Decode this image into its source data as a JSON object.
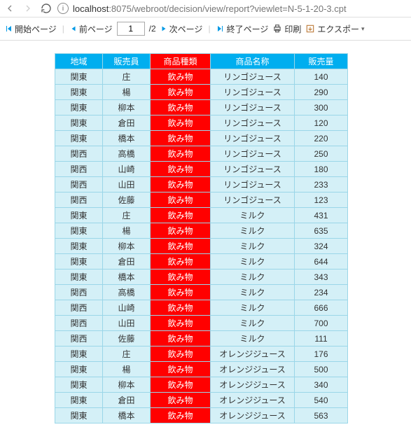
{
  "browser": {
    "url_host": "localhost",
    "url_port": ":8075",
    "url_path": "/webroot/decision/view/report?viewlet=N-5-1-20-3.cpt"
  },
  "toolbar": {
    "first_page": "開始ページ",
    "prev_page": "前ページ",
    "page_current": "1",
    "page_total": "/2",
    "next_page": "次ページ",
    "last_page": "終了ページ",
    "print": "印刷",
    "export": "エクスポー"
  },
  "table": {
    "headers": {
      "region": "地域",
      "seller": "販売員",
      "type": "商品種類",
      "name": "商品名称",
      "qty": "販売量"
    },
    "rows": [
      {
        "region": "関東",
        "seller": "庄",
        "type": "飲み物",
        "name": "リンゴジュース",
        "qty": 140
      },
      {
        "region": "関東",
        "seller": "楊",
        "type": "飲み物",
        "name": "リンゴジュース",
        "qty": 290
      },
      {
        "region": "関東",
        "seller": "柳本",
        "type": "飲み物",
        "name": "リンゴジュース",
        "qty": 300
      },
      {
        "region": "関東",
        "seller": "倉田",
        "type": "飲み物",
        "name": "リンゴジュース",
        "qty": 120
      },
      {
        "region": "関東",
        "seller": "橋本",
        "type": "飲み物",
        "name": "リンゴジュース",
        "qty": 220
      },
      {
        "region": "関西",
        "seller": "高橋",
        "type": "飲み物",
        "name": "リンゴジュース",
        "qty": 250
      },
      {
        "region": "関西",
        "seller": "山崎",
        "type": "飲み物",
        "name": "リンゴジュース",
        "qty": 180
      },
      {
        "region": "関西",
        "seller": "山田",
        "type": "飲み物",
        "name": "リンゴジュース",
        "qty": 233
      },
      {
        "region": "関西",
        "seller": "佐藤",
        "type": "飲み物",
        "name": "リンゴジュース",
        "qty": 123
      },
      {
        "region": "関東",
        "seller": "庄",
        "type": "飲み物",
        "name": "ミルク",
        "qty": 431
      },
      {
        "region": "関東",
        "seller": "楊",
        "type": "飲み物",
        "name": "ミルク",
        "qty": 635
      },
      {
        "region": "関東",
        "seller": "柳本",
        "type": "飲み物",
        "name": "ミルク",
        "qty": 324
      },
      {
        "region": "関東",
        "seller": "倉田",
        "type": "飲み物",
        "name": "ミルク",
        "qty": 644
      },
      {
        "region": "関東",
        "seller": "橋本",
        "type": "飲み物",
        "name": "ミルク",
        "qty": 343
      },
      {
        "region": "関西",
        "seller": "高橋",
        "type": "飲み物",
        "name": "ミルク",
        "qty": 234
      },
      {
        "region": "関西",
        "seller": "山崎",
        "type": "飲み物",
        "name": "ミルク",
        "qty": 666
      },
      {
        "region": "関西",
        "seller": "山田",
        "type": "飲み物",
        "name": "ミルク",
        "qty": 700
      },
      {
        "region": "関西",
        "seller": "佐藤",
        "type": "飲み物",
        "name": "ミルク",
        "qty": 111
      },
      {
        "region": "関東",
        "seller": "庄",
        "type": "飲み物",
        "name": "オレンジジュース",
        "qty": 176
      },
      {
        "region": "関東",
        "seller": "楊",
        "type": "飲み物",
        "name": "オレンジジュース",
        "qty": 500
      },
      {
        "region": "関東",
        "seller": "柳本",
        "type": "飲み物",
        "name": "オレンジジュース",
        "qty": 340
      },
      {
        "region": "関東",
        "seller": "倉田",
        "type": "飲み物",
        "name": "オレンジジュース",
        "qty": 540
      },
      {
        "region": "関東",
        "seller": "橋本",
        "type": "飲み物",
        "name": "オレンジジュース",
        "qty": 563
      }
    ]
  }
}
